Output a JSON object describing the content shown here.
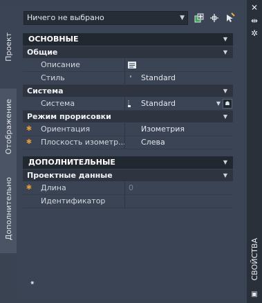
{
  "left_tabs": [
    "Проект",
    "Отображение",
    "Дополнительно"
  ],
  "palette_title": "СВОЙСТВА",
  "selection": {
    "value": "Ничего не выбрано"
  },
  "sections": {
    "main": "ОСНОВНЫЕ",
    "general": "Общие",
    "system_group": "Система",
    "render_mode": "Режим прорисовки",
    "extra": "ДОПОЛНИТЕЛЬНЫЕ",
    "project_data": "Проектные данные"
  },
  "props": {
    "description": {
      "name": "Описание",
      "value": ""
    },
    "style": {
      "name": "Стиль",
      "value": "Standard"
    },
    "system": {
      "name": "Система",
      "value": "Standard"
    },
    "orientation": {
      "name": "Ориентация",
      "value": "Изометрия"
    },
    "iso_plane": {
      "name": "Плоскость изометр...",
      "value": "Слева"
    },
    "length": {
      "name": "Длина",
      "value": "0"
    },
    "identifier": {
      "name": "Идентификатор",
      "value": ""
    }
  },
  "icons": {
    "close": "close-icon",
    "autohide": "autohide-icon",
    "settings": "settings-icon",
    "quick_select": "quick-select-icon",
    "pick_add": "pick-add-icon",
    "select_objects": "select-objects-icon"
  },
  "colors": {
    "asterisk": "#e39b3a",
    "category_bg": "#222830",
    "panel_bg": "#3b4454"
  }
}
